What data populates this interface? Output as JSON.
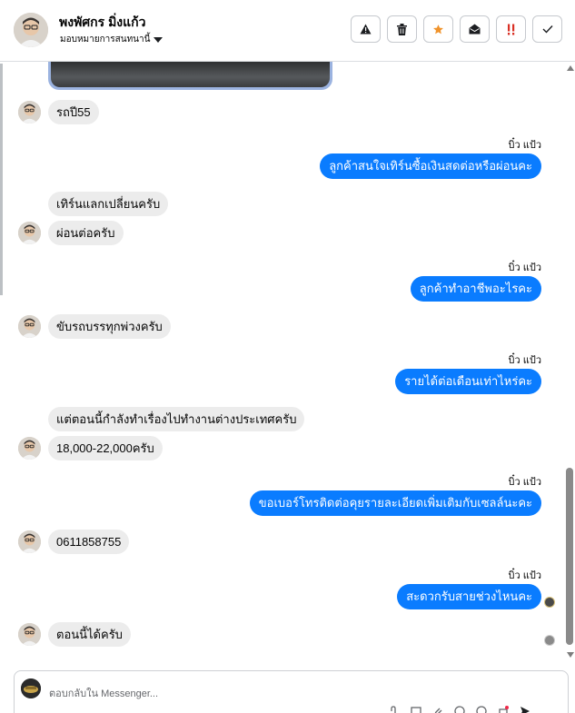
{
  "header": {
    "contact_name": "พงพัศกร มิ่งแก้ว",
    "assign_label": "มอบหมายการสนทนานี้",
    "actions": [
      {
        "icon": "warning-icon"
      },
      {
        "icon": "trash-icon"
      },
      {
        "icon": "star-icon",
        "color": "#f0932b"
      },
      {
        "icon": "mail-open-icon"
      },
      {
        "icon": "urgent-icon",
        "color": "#d93025"
      },
      {
        "icon": "check-icon"
      }
    ]
  },
  "messages": [
    {
      "dir": "in",
      "text": "รถปี55",
      "avatar": true
    },
    {
      "dir": "out",
      "sender": "บิ๋ว แป้ว",
      "text": "ลูกค้าสนใจเทิร์นซื้อเงินสดต่อหรือผ่อนคะ"
    },
    {
      "dir": "in",
      "text": "เทิร์นแลกเปลี่ยนครับ",
      "avatar": false
    },
    {
      "dir": "in",
      "text": "ผ่อนต่อครับ",
      "avatar": true
    },
    {
      "dir": "out",
      "sender": "บิ๋ว แป้ว",
      "text": "ลูกค้าทำอาชีพอะไรคะ"
    },
    {
      "dir": "in",
      "text": "ขับรถบรรทุกพ่วงครับ",
      "avatar": true
    },
    {
      "dir": "out",
      "sender": "บิ๋ว แป้ว",
      "text": "รายได้ต่อเดือนเท่าไหร่คะ"
    },
    {
      "dir": "in",
      "text": "แต่ตอนนี้กำลังทำเรื่องไปทำงานต่างประเทศครับ",
      "avatar": false
    },
    {
      "dir": "in",
      "text": "18,000-22,000ครับ",
      "avatar": true
    },
    {
      "dir": "out",
      "sender": "บิ๋ว แป้ว",
      "text": "ขอเบอร์โทรติดต่อคุยรายละเอียดเพิ่มเติมกับเซลล์นะคะ"
    },
    {
      "dir": "in",
      "text": "0611858755",
      "avatar": true
    },
    {
      "dir": "out",
      "sender": "บิ๋ว แป้ว",
      "text": "สะดวกรับสายช่วงไหนคะ"
    },
    {
      "dir": "in",
      "text": "ตอนนี้ได้ครับ",
      "avatar": true
    }
  ],
  "composer": {
    "placeholder": "ตอบกลับใน Messenger..."
  },
  "colors": {
    "outgoing_bubble": "#0a7cff",
    "incoming_bubble": "#ececec"
  }
}
